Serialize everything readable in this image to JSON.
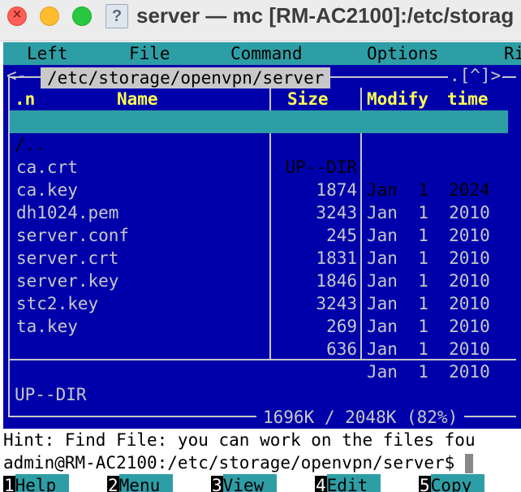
{
  "window": {
    "title": "server — mc [RM-AC2100]:/etc/storag",
    "proxy_icon": "document-question-icon"
  },
  "menu": {
    "left": "Left",
    "file": "File",
    "command": "Command",
    "options": "Options",
    "right": "Ri"
  },
  "panel": {
    "path": "/etc/storage/openvpn/server",
    "corner_left": "<-",
    "corner_right": ".[^]>",
    "headers": {
      "sort": ".n",
      "name": "Name",
      "size": "Size",
      "modify": "Modify",
      "time": "time"
    },
    "files": [
      {
        "name": "/..",
        "size": "UP--DIR",
        "date": "Jan  1  2024",
        "selected": true
      },
      {
        "name": "ca.crt",
        "size": "1874",
        "date": "Jan  1  2010"
      },
      {
        "name": "ca.key",
        "size": "3243",
        "date": "Jan  1  2010"
      },
      {
        "name": "dh1024.pem",
        "size": "245",
        "date": "Jan  1  2010"
      },
      {
        "name": "server.conf",
        "size": "1831",
        "date": "Jan  1  2010"
      },
      {
        "name": "server.crt",
        "size": "1846",
        "date": "Jan  1  2010"
      },
      {
        "name": "server.key",
        "size": "3243",
        "date": "Jan  1  2010"
      },
      {
        "name": "stc2.key",
        "size": "269",
        "date": "Jan  1  2010"
      },
      {
        "name": "ta.key",
        "size": "636",
        "date": "Jan  1  2010"
      }
    ],
    "status": "UP--DIR",
    "usage": "1696K / 2048K (82%)"
  },
  "hint": "Hint: Find File: you can work on the files fou",
  "prompt": "admin@RM-AC2100:/etc/storage/openvpn/server$ ",
  "fkeys": [
    {
      "num": "1",
      "label": "Help"
    },
    {
      "num": "2",
      "label": "Menu"
    },
    {
      "num": "3",
      "label": "View"
    },
    {
      "num": "4",
      "label": "Edit"
    },
    {
      "num": "5",
      "label": "Copy"
    }
  ]
}
